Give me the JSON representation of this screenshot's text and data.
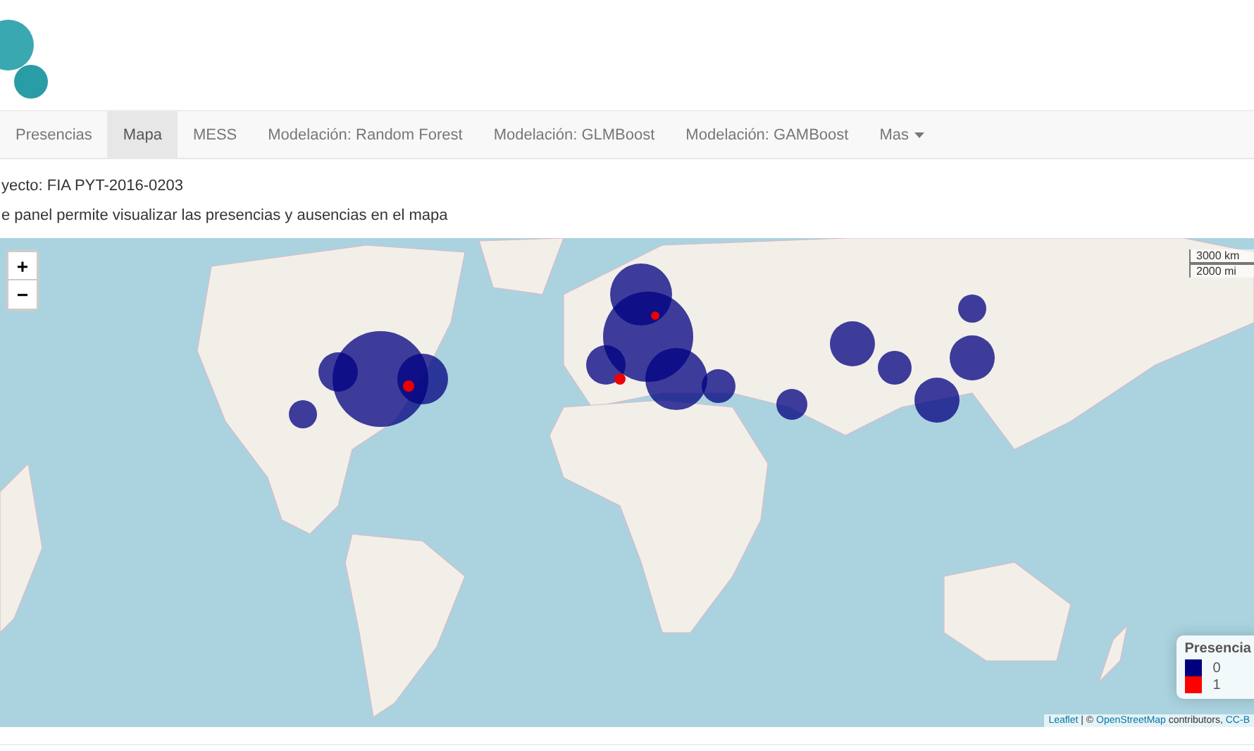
{
  "nav": {
    "tabs": [
      {
        "label": "Presencias",
        "selected": false
      },
      {
        "label": "Mapa",
        "selected": true
      },
      {
        "label": "MESS",
        "selected": false
      },
      {
        "label": "Modelación: Random Forest",
        "selected": false
      },
      {
        "label": "Modelación: GLMBoost",
        "selected": false
      },
      {
        "label": "Modelación: GAMBoost",
        "selected": false
      },
      {
        "label": "Mas",
        "selected": false,
        "kind": "dropdown"
      }
    ]
  },
  "project": "yecto: FIA PYT-2016-0203",
  "description": "e panel permite visualizar las presencias y ausencias en el mapa",
  "map": {
    "zoom_in": "+",
    "zoom_out": "−",
    "scale": [
      "3000 km",
      "2000 mi"
    ],
    "legend": {
      "title": "Presencia",
      "items": [
        {
          "label": "0",
          "color": "#00007f"
        },
        {
          "label": "1",
          "color": "#ff0000"
        }
      ]
    },
    "attribution": {
      "leaflet": "Leaflet",
      "separator": " | © ",
      "osm": "OpenStreetMap",
      "contributors": " contributors, ",
      "license": "CC-B"
    }
  }
}
